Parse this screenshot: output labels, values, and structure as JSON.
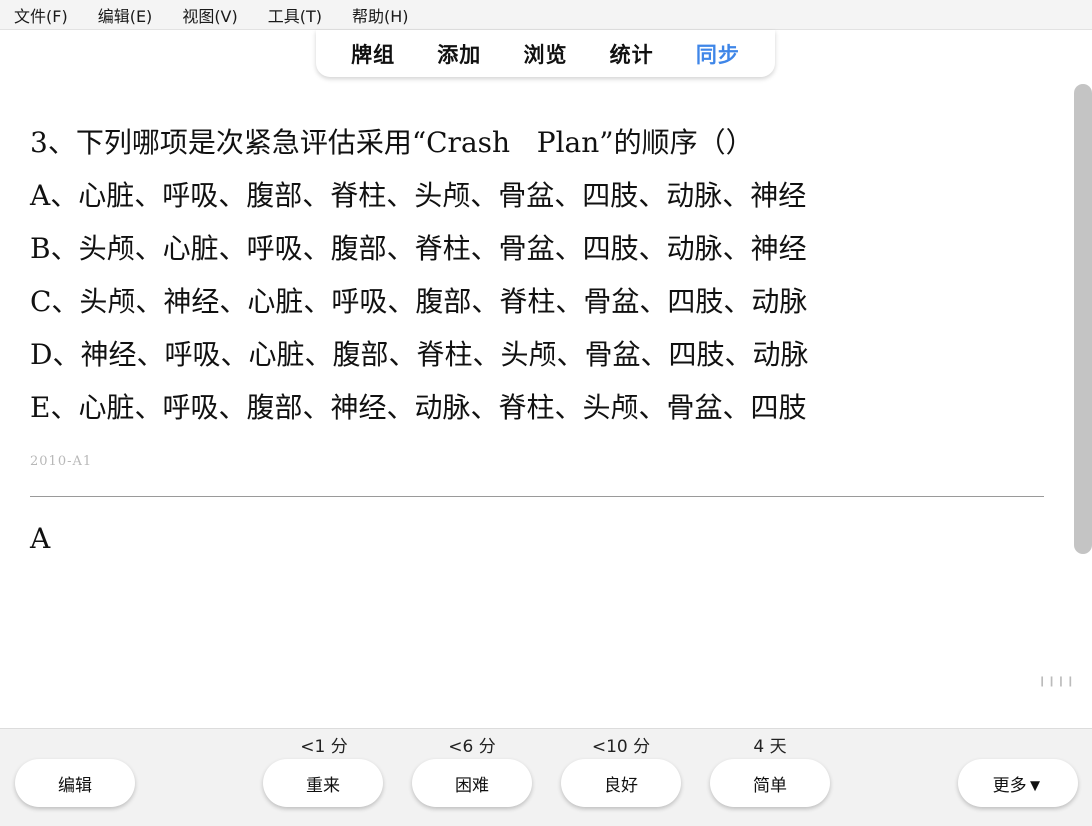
{
  "menu": [
    "文件(F)",
    "编辑(E)",
    "视图(V)",
    "工具(T)",
    "帮助(H)"
  ],
  "nav": {
    "tabs": [
      "牌组",
      "添加",
      "浏览",
      "统计",
      "同步"
    ],
    "active": "同步"
  },
  "card": {
    "question": "3、下列哪项是次紧急评估采用“Crash   Plan”的顺序（）",
    "options": [
      "A、心脏、呼吸、腹部、脊柱、头颅、骨盆、四肢、动脉、神经",
      "B、头颅、心脏、呼吸、腹部、脊柱、骨盆、四肢、动脉、神经",
      "C、头颅、神经、心脏、呼吸、腹部、脊柱、骨盆、四肢、动脉",
      "D、神经、呼吸、心脏、腹部、脊柱、头颅、骨盆、四肢、动脉",
      "E、心脏、呼吸、腹部、神经、动脉、脊柱、头颅、骨盆、四肢"
    ],
    "source": "2010-A1",
    "answer": "A"
  },
  "bottom": {
    "edit_label": "编辑",
    "more_label": "更多▼",
    "answers": [
      {
        "interval": "<1 分",
        "label": "重来"
      },
      {
        "interval": "<6 分",
        "label": "困难"
      },
      {
        "interval": "<10 分",
        "label": "良好"
      },
      {
        "interval": "4 天",
        "label": "简单"
      }
    ]
  },
  "colors": {
    "accent": "#3f86e8"
  }
}
